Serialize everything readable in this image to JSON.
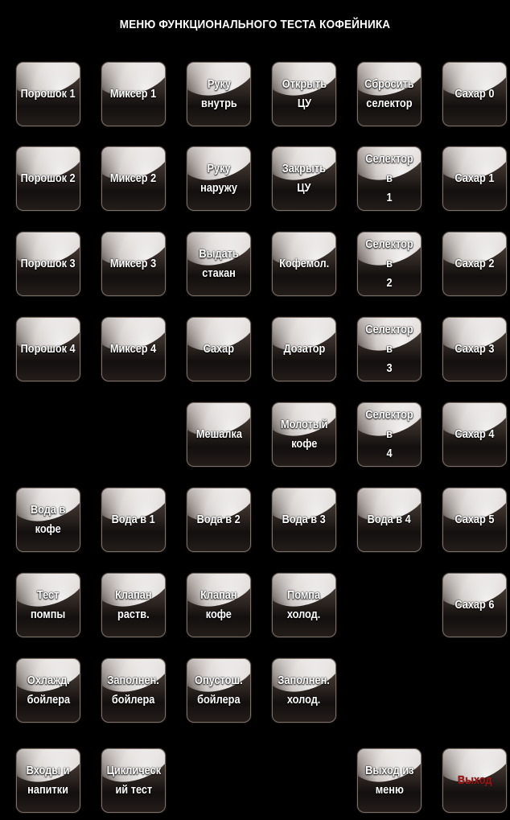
{
  "title": "МЕНЮ ФУНКЦИОНАЛЬНОГО ТЕСТА КОФЕЙНИКА",
  "buttons": {
    "powder1": "Порошок 1",
    "mixer1": "Миксер 1",
    "arm_in": "Руку\nвнутрь",
    "open_cu": "Открыть\nЦУ",
    "reset_selector": "Сбросить\nселектор",
    "sugar0": "Сахар 0",
    "powder2": "Порошок 2",
    "mixer2": "Миксер 2",
    "arm_out": "Руку\nнаружу",
    "close_cu": "Закрыть\nЦУ",
    "selector1": "Селектор в\n1",
    "sugar1": "Сахар 1",
    "powder3": "Порошок 3",
    "mixer3": "Миксер 3",
    "dispense_cup": "Выдать\nстакан",
    "grinder": "Кофемол.",
    "selector2": "Селектор в\n2",
    "sugar2": "Сахар 2",
    "powder4": "Порошок 4",
    "mixer4": "Миксер 4",
    "sugar": "Сахар",
    "dispenser": "Дозатор",
    "selector3": "Селектор в\n3",
    "sugar3": "Сахар 3",
    "stirrer": "Мешалка",
    "ground_coffee": "Молотый\nкофе",
    "selector4": "Селектор в\n4",
    "sugar4": "Сахар 4",
    "water_coffee": "Вода в\nкофе",
    "water1": "Вода в 1",
    "water2": "Вода в 2",
    "water3": "Вода в 3",
    "water4": "Вода в 4",
    "sugar5": "Сахар 5",
    "pump_test": "Тест\nпомпы",
    "valve_solution": "Клапан\nраств.",
    "valve_coffee": "Клапан\nкофе",
    "pump_cold": "Помпа\nхолод.",
    "sugar6": "Сахар 6",
    "cool_boiler": "Охлажд.\nбойлера",
    "fill_boiler": "Заполнен.\nбойлера",
    "empty_boiler": "Опустош.\nбойлера",
    "fill_cold": "Заполнен.\nхолод.",
    "inputs_drinks": "Входы и\nнапитки",
    "cyclic_test": "Циклическ\nий тест",
    "exit_menu": "Выход из\nменю",
    "exit": "Выход"
  },
  "colors": {
    "background": "#000000",
    "text": "#ffffff",
    "exit_text": "#a31414"
  }
}
